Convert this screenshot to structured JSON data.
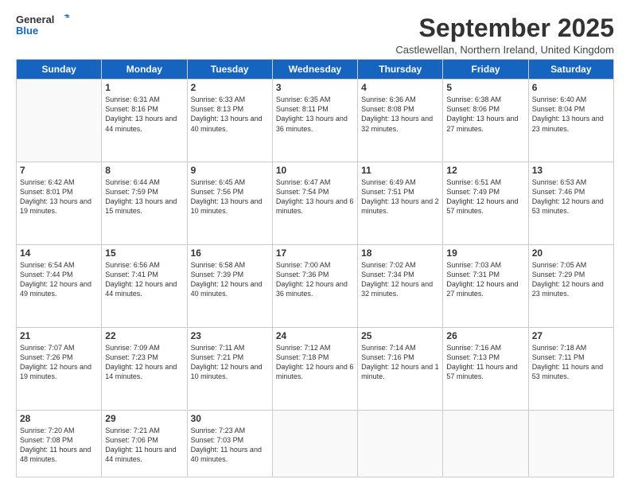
{
  "logo": {
    "line1": "General",
    "line2": "Blue"
  },
  "title": "September 2025",
  "location": "Castlewellan, Northern Ireland, United Kingdom",
  "days_of_week": [
    "Sunday",
    "Monday",
    "Tuesday",
    "Wednesday",
    "Thursday",
    "Friday",
    "Saturday"
  ],
  "weeks": [
    [
      {
        "day": "",
        "detail": ""
      },
      {
        "day": "1",
        "detail": "Sunrise: 6:31 AM\nSunset: 8:16 PM\nDaylight: 13 hours\nand 44 minutes."
      },
      {
        "day": "2",
        "detail": "Sunrise: 6:33 AM\nSunset: 8:13 PM\nDaylight: 13 hours\nand 40 minutes."
      },
      {
        "day": "3",
        "detail": "Sunrise: 6:35 AM\nSunset: 8:11 PM\nDaylight: 13 hours\nand 36 minutes."
      },
      {
        "day": "4",
        "detail": "Sunrise: 6:36 AM\nSunset: 8:08 PM\nDaylight: 13 hours\nand 32 minutes."
      },
      {
        "day": "5",
        "detail": "Sunrise: 6:38 AM\nSunset: 8:06 PM\nDaylight: 13 hours\nand 27 minutes."
      },
      {
        "day": "6",
        "detail": "Sunrise: 6:40 AM\nSunset: 8:04 PM\nDaylight: 13 hours\nand 23 minutes."
      }
    ],
    [
      {
        "day": "7",
        "detail": "Sunrise: 6:42 AM\nSunset: 8:01 PM\nDaylight: 13 hours\nand 19 minutes."
      },
      {
        "day": "8",
        "detail": "Sunrise: 6:44 AM\nSunset: 7:59 PM\nDaylight: 13 hours\nand 15 minutes."
      },
      {
        "day": "9",
        "detail": "Sunrise: 6:45 AM\nSunset: 7:56 PM\nDaylight: 13 hours\nand 10 minutes."
      },
      {
        "day": "10",
        "detail": "Sunrise: 6:47 AM\nSunset: 7:54 PM\nDaylight: 13 hours\nand 6 minutes."
      },
      {
        "day": "11",
        "detail": "Sunrise: 6:49 AM\nSunset: 7:51 PM\nDaylight: 13 hours\nand 2 minutes."
      },
      {
        "day": "12",
        "detail": "Sunrise: 6:51 AM\nSunset: 7:49 PM\nDaylight: 12 hours\nand 57 minutes."
      },
      {
        "day": "13",
        "detail": "Sunrise: 6:53 AM\nSunset: 7:46 PM\nDaylight: 12 hours\nand 53 minutes."
      }
    ],
    [
      {
        "day": "14",
        "detail": "Sunrise: 6:54 AM\nSunset: 7:44 PM\nDaylight: 12 hours\nand 49 minutes."
      },
      {
        "day": "15",
        "detail": "Sunrise: 6:56 AM\nSunset: 7:41 PM\nDaylight: 12 hours\nand 44 minutes."
      },
      {
        "day": "16",
        "detail": "Sunrise: 6:58 AM\nSunset: 7:39 PM\nDaylight: 12 hours\nand 40 minutes."
      },
      {
        "day": "17",
        "detail": "Sunrise: 7:00 AM\nSunset: 7:36 PM\nDaylight: 12 hours\nand 36 minutes."
      },
      {
        "day": "18",
        "detail": "Sunrise: 7:02 AM\nSunset: 7:34 PM\nDaylight: 12 hours\nand 32 minutes."
      },
      {
        "day": "19",
        "detail": "Sunrise: 7:03 AM\nSunset: 7:31 PM\nDaylight: 12 hours\nand 27 minutes."
      },
      {
        "day": "20",
        "detail": "Sunrise: 7:05 AM\nSunset: 7:29 PM\nDaylight: 12 hours\nand 23 minutes."
      }
    ],
    [
      {
        "day": "21",
        "detail": "Sunrise: 7:07 AM\nSunset: 7:26 PM\nDaylight: 12 hours\nand 19 minutes."
      },
      {
        "day": "22",
        "detail": "Sunrise: 7:09 AM\nSunset: 7:23 PM\nDaylight: 12 hours\nand 14 minutes."
      },
      {
        "day": "23",
        "detail": "Sunrise: 7:11 AM\nSunset: 7:21 PM\nDaylight: 12 hours\nand 10 minutes."
      },
      {
        "day": "24",
        "detail": "Sunrise: 7:12 AM\nSunset: 7:18 PM\nDaylight: 12 hours\nand 6 minutes."
      },
      {
        "day": "25",
        "detail": "Sunrise: 7:14 AM\nSunset: 7:16 PM\nDaylight: 12 hours\nand 1 minute."
      },
      {
        "day": "26",
        "detail": "Sunrise: 7:16 AM\nSunset: 7:13 PM\nDaylight: 11 hours\nand 57 minutes."
      },
      {
        "day": "27",
        "detail": "Sunrise: 7:18 AM\nSunset: 7:11 PM\nDaylight: 11 hours\nand 53 minutes."
      }
    ],
    [
      {
        "day": "28",
        "detail": "Sunrise: 7:20 AM\nSunset: 7:08 PM\nDaylight: 11 hours\nand 48 minutes."
      },
      {
        "day": "29",
        "detail": "Sunrise: 7:21 AM\nSunset: 7:06 PM\nDaylight: 11 hours\nand 44 minutes."
      },
      {
        "day": "30",
        "detail": "Sunrise: 7:23 AM\nSunset: 7:03 PM\nDaylight: 11 hours\nand 40 minutes."
      },
      {
        "day": "",
        "detail": ""
      },
      {
        "day": "",
        "detail": ""
      },
      {
        "day": "",
        "detail": ""
      },
      {
        "day": "",
        "detail": ""
      }
    ]
  ]
}
